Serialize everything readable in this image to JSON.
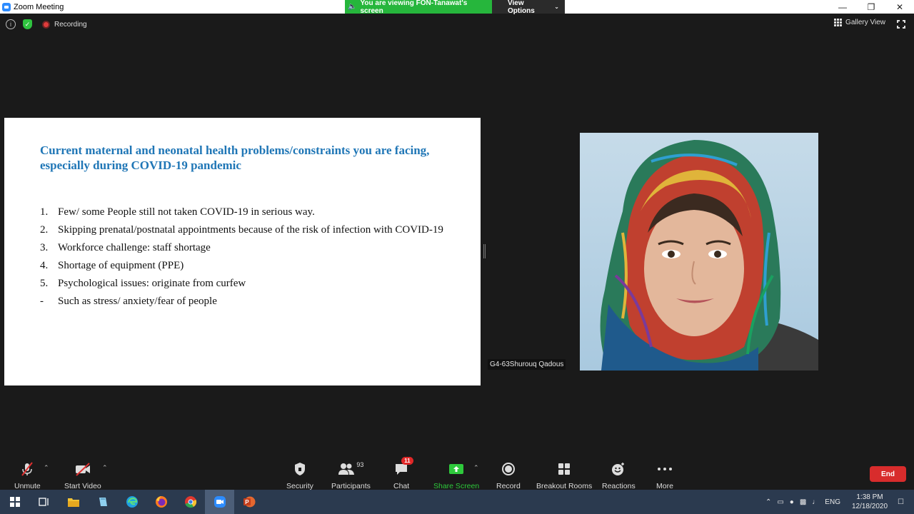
{
  "window": {
    "title": "Zoom Meeting"
  },
  "banner": {
    "viewing_text": "You are viewing FON-Tanawat's screen",
    "view_options": "View Options"
  },
  "top": {
    "recording": "Recording",
    "gallery_view": "Gallery View"
  },
  "slide": {
    "title": "Current maternal and neonatal health problems/constraints you are facing, especially during COVID-19 pandemic",
    "items": [
      {
        "marker": "1.",
        "text": "Few/ some People still not taken COVID-19 in serious way."
      },
      {
        "marker": "2.",
        "text": "Skipping prenatal/postnatal appointments because of the risk of infection with COVID-19"
      },
      {
        "marker": "3.",
        "text": "Workforce challenge: staff shortage"
      },
      {
        "marker": "4.",
        "text": "Shortage of equipment (PPE)"
      },
      {
        "marker": "5.",
        "text": "Psychological issues: originate from curfew"
      },
      {
        "marker": "-",
        "text": "Such as stress/ anxiety/fear  of people"
      }
    ]
  },
  "participant": {
    "name": "G4-63Shurouq Qadous"
  },
  "toolbar": {
    "unmute": "Unmute",
    "start_video": "Start Video",
    "security": "Security",
    "participants": "Participants",
    "participants_count": "93",
    "chat": "Chat",
    "chat_badge": "11",
    "share_screen": "Share Screen",
    "record": "Record",
    "breakout_rooms": "Breakout Rooms",
    "reactions": "Reactions",
    "more": "More",
    "end": "End"
  },
  "taskbar": {
    "language": "ENG",
    "time": "1:38 PM",
    "date": "12/18/2020"
  },
  "colors": {
    "share_green": "#2ec93c",
    "end_red": "#d82c2c",
    "banner_green": "#26b63c",
    "slide_title_blue": "#1f76b6"
  }
}
